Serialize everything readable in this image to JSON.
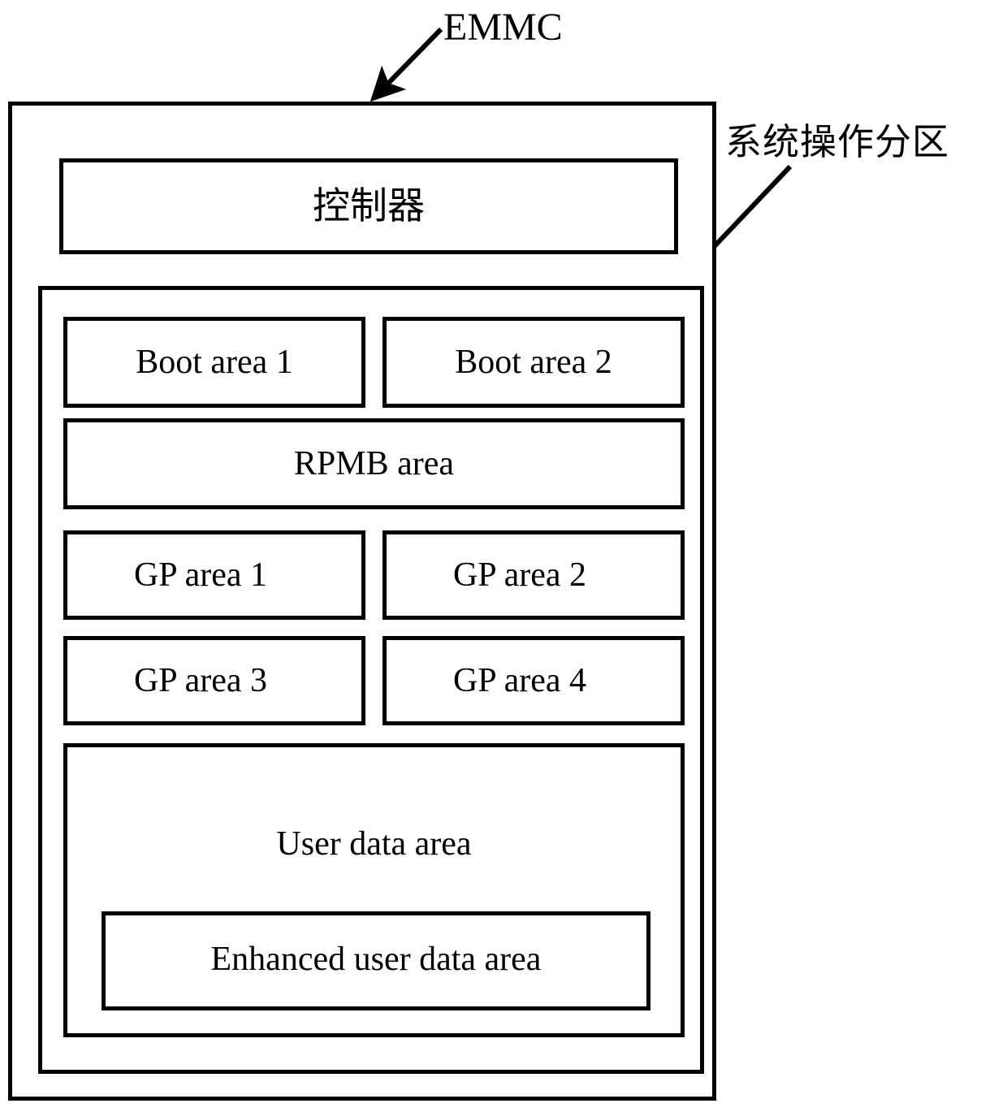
{
  "figure": {
    "type": "block-diagram",
    "title_callouts": {
      "outer_label": "EMMC",
      "partition_label": "系统操作分区"
    }
  },
  "emmc": {
    "name": "EMMC",
    "controller": {
      "label": "控制器"
    },
    "partition": {
      "name": "系统操作分区",
      "areas": {
        "boot_1": "Boot area 1",
        "boot_2": "Boot area 2",
        "rpmb": "RPMB area",
        "gp_1": "GP area 1",
        "gp_2": "GP area 2",
        "gp_3": "GP area 3",
        "gp_4": "GP area 4",
        "user_data": "User data area",
        "enhanced_user_data": "Enhanced user data area"
      }
    }
  },
  "colors": {
    "stroke": "#000000",
    "fill": "#ffffff",
    "text": "#000000"
  }
}
